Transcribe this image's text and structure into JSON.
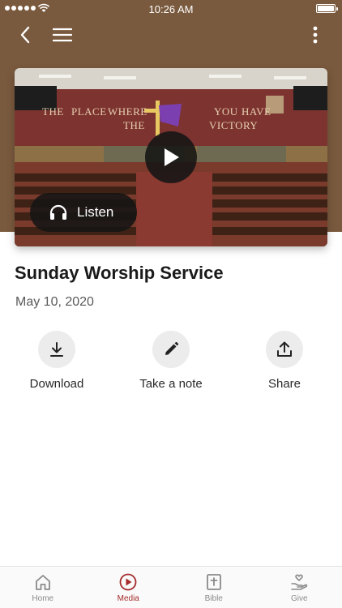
{
  "status_bar": {
    "time": "10:26 AM"
  },
  "nav": {
    "back_icon": "chevron-left-icon",
    "menu_icon": "hamburger-icon",
    "more_icon": "more-vertical-icon"
  },
  "media": {
    "thumbnail_banner_text": [
      "THE",
      "PLACE",
      "WHERE",
      "YOU",
      "HAVE",
      "THE",
      "VICTORY"
    ],
    "play_icon": "play-icon",
    "listen_label": "Listen",
    "title": "Sunday Worship Service",
    "date": "May 10, 2020"
  },
  "actions": [
    {
      "label": "Download",
      "icon": "download-icon"
    },
    {
      "label": "Take a note",
      "icon": "pencil-icon"
    },
    {
      "label": "Share",
      "icon": "share-icon"
    }
  ],
  "tabbar": {
    "items": [
      {
        "label": "Home",
        "icon": "home-icon",
        "active": false
      },
      {
        "label": "Media",
        "icon": "play-circle-icon",
        "active": true
      },
      {
        "label": "Bible",
        "icon": "bible-icon",
        "active": false
      },
      {
        "label": "Give",
        "icon": "give-icon",
        "active": false
      }
    ]
  },
  "colors": {
    "header_brown": "#7a5a3e",
    "accent_red": "#a52a2a",
    "tab_gray": "#8a8a8a"
  }
}
